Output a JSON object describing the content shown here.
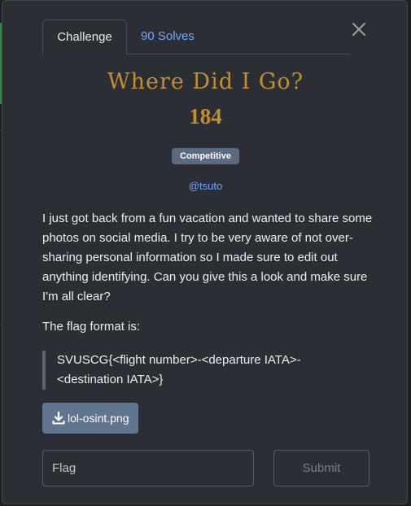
{
  "tabs": [
    {
      "label": "Challenge",
      "active": true
    },
    {
      "label": "90 Solves",
      "active": false
    }
  ],
  "challenge": {
    "title": "Where Did I Go?",
    "points": "184",
    "tag": "Competitive",
    "author": "@tsuto",
    "description": "I just got back from a fun vacation and wanted to share some photos on social media. I try to be very aware of not over-sharing personal information so I made sure to edit out anything identifying. Can you give this a look and make sure I'm all clear?",
    "flag_intro": "The flag format is:",
    "flag_format_line1": "SVUSCG{<flight number>-<departure IATA>-",
    "flag_format_line2": "<destination IATA>}",
    "file_label": "lol-osint.png"
  },
  "form": {
    "flag_placeholder": "Flag",
    "flag_value": "",
    "submit_label": "Submit"
  },
  "icons": {
    "close": "close-icon",
    "download": "download-icon"
  },
  "colors": {
    "accent_gold": "#c18f2e",
    "link_blue": "#6ea8fe",
    "badge_bg": "#5a6a80",
    "button_bg": "#607590",
    "modal_bg": "#2b2f35"
  }
}
